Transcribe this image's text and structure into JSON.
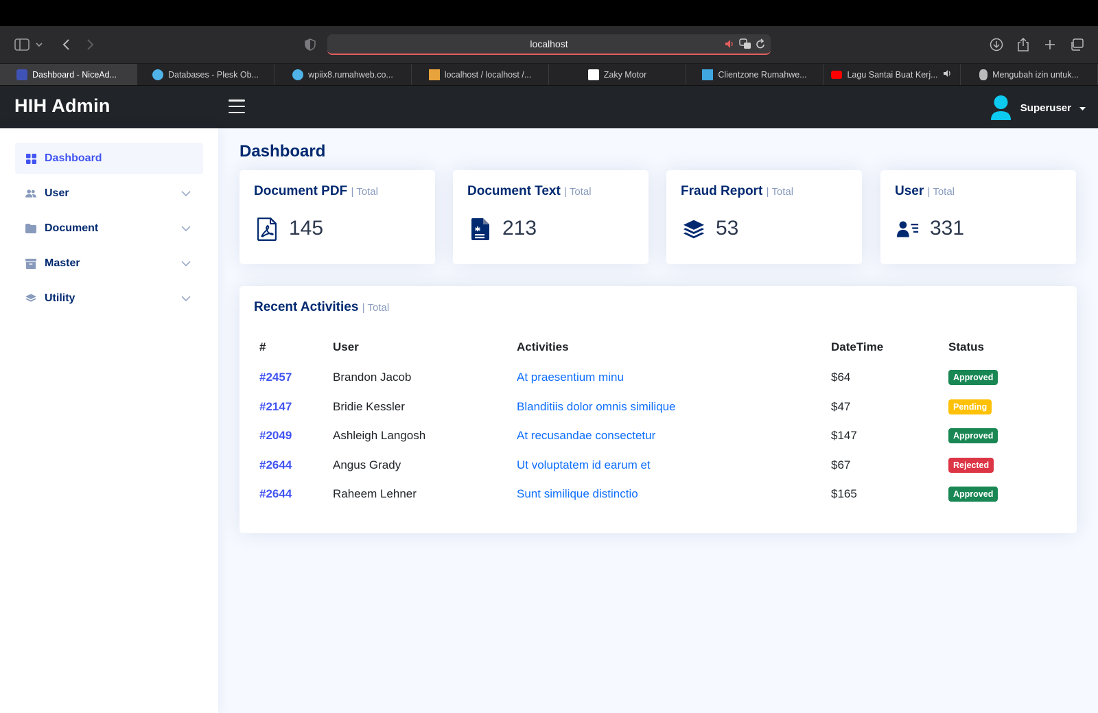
{
  "browser": {
    "url": "localhost",
    "tabs": [
      {
        "title": "Dashboard - NiceAd...",
        "fav_color": "#3f52b5"
      },
      {
        "title": "Databases - Plesk Ob...",
        "fav_color": "#4fb3e8"
      },
      {
        "title": "wpiix8.rumahweb.co...",
        "fav_color": "#4fb3e8"
      },
      {
        "title": "localhost / localhost /...",
        "fav_color": "#e8a33c"
      },
      {
        "title": "Zaky Motor",
        "fav_color": "#ffffff"
      },
      {
        "title": "Clientzone Rumahwe...",
        "fav_color": "#3fa6e0"
      },
      {
        "title": "Lagu Santai Buat Kerj...",
        "fav_color": "#ff0000"
      },
      {
        "title": "Mengubah izin untuk...",
        "fav_color": "#bbbbbb"
      }
    ]
  },
  "header": {
    "brand": "HIH Admin",
    "user": "Superuser"
  },
  "sidebar": {
    "items": [
      {
        "label": "Dashboard",
        "icon": "grid-icon"
      },
      {
        "label": "User",
        "icon": "people-icon"
      },
      {
        "label": "Document",
        "icon": "folder-icon"
      },
      {
        "label": "Master",
        "icon": "archive-icon"
      },
      {
        "label": "Utility",
        "icon": "layers-icon"
      }
    ]
  },
  "page": {
    "title": "Dashboard"
  },
  "stats": [
    {
      "title": "Document PDF",
      "sub": "| Total",
      "value": "145",
      "icon": "pdf-icon"
    },
    {
      "title": "Document Text",
      "sub": "| Total",
      "value": "213",
      "icon": "file-text-icon"
    },
    {
      "title": "Fraud Report",
      "sub": "| Total",
      "value": "53",
      "icon": "layers-icon"
    },
    {
      "title": "User",
      "sub": "| Total",
      "value": "331",
      "icon": "user-list-icon"
    }
  ],
  "recent": {
    "title": "Recent Activities",
    "sub": "| Total",
    "headers": [
      "#",
      "User",
      "Activities",
      "DateTime",
      "Status"
    ],
    "rows": [
      {
        "id": "#2457",
        "user": "Brandon Jacob",
        "activity": "At praesentium minu",
        "datetime": "$64",
        "status": "Approved",
        "status_color": "#198754"
      },
      {
        "id": "#2147",
        "user": "Bridie Kessler",
        "activity": "Blanditiis dolor omnis similique",
        "datetime": "$47",
        "status": "Pending",
        "status_color": "#ffc107"
      },
      {
        "id": "#2049",
        "user": "Ashleigh Langosh",
        "activity": "At recusandae consectetur",
        "datetime": "$147",
        "status": "Approved",
        "status_color": "#198754"
      },
      {
        "id": "#2644",
        "user": "Angus Grady",
        "activity": "Ut voluptatem id earum et",
        "datetime": "$67",
        "status": "Rejected",
        "status_color": "#dc3545"
      },
      {
        "id": "#2644",
        "user": "Raheem Lehner",
        "activity": "Sunt similique distinctio",
        "datetime": "$165",
        "status": "Approved",
        "status_color": "#198754"
      }
    ]
  }
}
